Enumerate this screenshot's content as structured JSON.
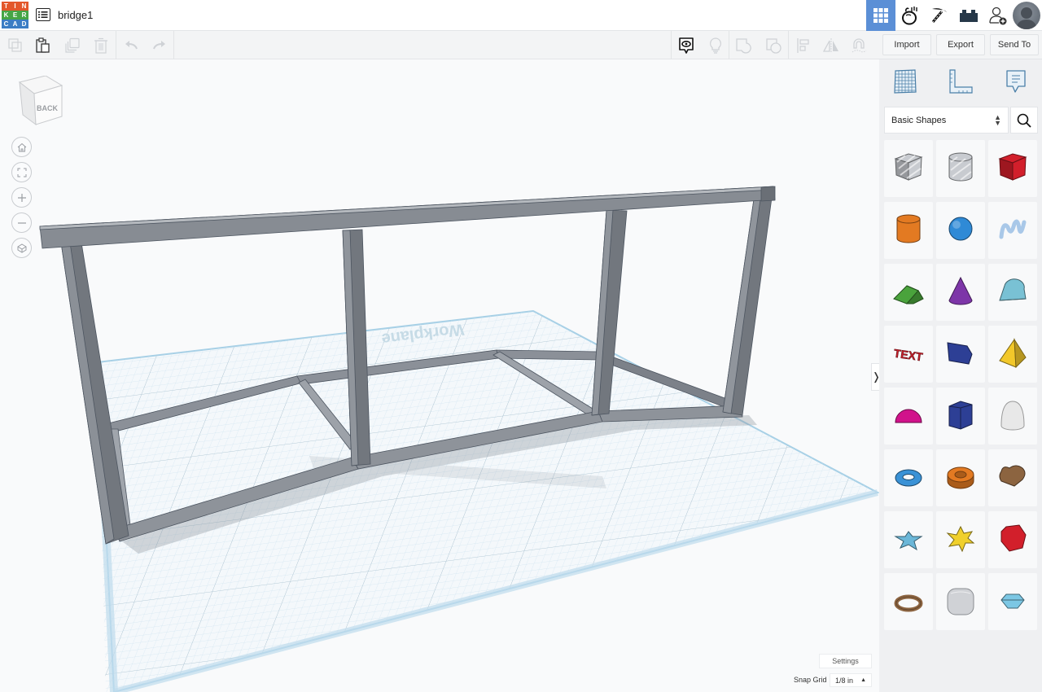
{
  "app": {
    "logo_letters": [
      "T",
      "I",
      "N",
      "K",
      "E",
      "R",
      "C",
      "A",
      "D"
    ],
    "logo_colors": [
      "#e3572b",
      "#e3572b",
      "#e3572b",
      "#46a546",
      "#46a546",
      "#46a546",
      "#3b7dc4",
      "#3b7dc4",
      "#3b7dc4"
    ],
    "document_title": "bridge1",
    "accent_color": "#5b8fd6"
  },
  "topbar": {
    "icons": [
      {
        "name": "3d-design-grid-icon",
        "active": true
      },
      {
        "name": "circuits-icon",
        "active": false
      },
      {
        "name": "minecraft-pickaxe-icon",
        "active": false
      },
      {
        "name": "lego-brick-icon",
        "active": false
      },
      {
        "name": "add-user-icon",
        "active": false
      },
      {
        "name": "user-avatar",
        "active": false
      }
    ]
  },
  "toolbar": {
    "left_tools": [
      "copy",
      "paste",
      "duplicate",
      "delete",
      "undo",
      "redo"
    ],
    "right_tools": [
      "show-notes",
      "lightbulb",
      "group",
      "ungroup",
      "align",
      "mirror",
      "magnet"
    ],
    "import_label": "Import",
    "export_label": "Export",
    "send_to_label": "Send To"
  },
  "viewport": {
    "viewcube_label": "BACK",
    "nav_buttons": [
      "home",
      "fit-all",
      "zoom-in",
      "zoom-out",
      "ortho-perspective"
    ],
    "workplane_label": "Workplane",
    "settings_label": "Settings",
    "snap_grid_label": "Snap Grid",
    "snap_grid_value": "1/8 in",
    "collapse_arrow": "❭"
  },
  "panel": {
    "tabs": [
      "workplane-tab",
      "ruler-tab",
      "notes-tab"
    ],
    "category_value": "Basic Shapes",
    "shapes": [
      {
        "name": "box-hole",
        "color": "#c8cbd0"
      },
      {
        "name": "cylinder-hole",
        "color": "#c8cbd0"
      },
      {
        "name": "box",
        "color": "#d21f2b"
      },
      {
        "name": "cylinder",
        "color": "#e37a22"
      },
      {
        "name": "sphere",
        "color": "#2f8ad6"
      },
      {
        "name": "scribble",
        "color": "#a9c8e8"
      },
      {
        "name": "roof",
        "color": "#4aa33c"
      },
      {
        "name": "cone",
        "color": "#7d36a8"
      },
      {
        "name": "round-roof",
        "color": "#79c1d4"
      },
      {
        "name": "text",
        "color": "#c8202b"
      },
      {
        "name": "wedge",
        "color": "#2d3f95"
      },
      {
        "name": "pyramid",
        "color": "#f2c82a"
      },
      {
        "name": "half-sphere",
        "color": "#d1138b"
      },
      {
        "name": "polygon",
        "color": "#2d3f95"
      },
      {
        "name": "paraboloid",
        "color": "#e8e8e8"
      },
      {
        "name": "torus",
        "color": "#3a92d6"
      },
      {
        "name": "tube",
        "color": "#e37a22"
      },
      {
        "name": "heart",
        "color": "#8c6440"
      },
      {
        "name": "star",
        "color": "#6bb7d8"
      },
      {
        "name": "star-six-point",
        "color": "#f0d02c"
      },
      {
        "name": "icosahedron",
        "color": "#d21f2b"
      },
      {
        "name": "ring",
        "color": "#8c6440"
      },
      {
        "name": "round-box",
        "color": "#d0d2d6"
      },
      {
        "name": "diamond",
        "color": "#7cc7e4"
      }
    ]
  }
}
